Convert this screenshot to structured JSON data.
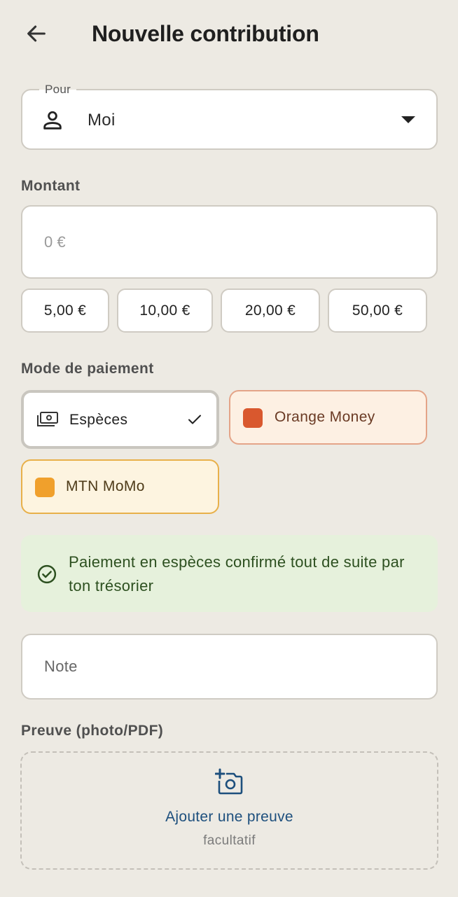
{
  "header": {
    "title": "Nouvelle contribution"
  },
  "pour": {
    "legend": "Pour",
    "value": "Moi"
  },
  "montant": {
    "label": "Montant",
    "placeholder": "0 €",
    "presets": [
      "5,00 €",
      "10,00 €",
      "20,00 €",
      "50,00 €"
    ]
  },
  "paiement": {
    "label": "Mode de paiement",
    "options": [
      {
        "label": "Espèces",
        "selected": true
      },
      {
        "label": "Orange Money",
        "selected": false,
        "color": "#d9582e"
      },
      {
        "label": "MTN MoMo",
        "selected": false,
        "color": "#f0a02c"
      }
    ]
  },
  "info": {
    "text": "Paiement en espèces confirmé tout de suite par ton trésorier"
  },
  "note": {
    "placeholder": "Note"
  },
  "preuve": {
    "label": "Preuve (photo/PDF)",
    "add_label": "Ajouter une preuve",
    "optional": "facultatif"
  },
  "colors": {
    "background": "#edeae3",
    "accent_blue": "#1d4f7d",
    "success_bg": "#e6f1dc",
    "success_text": "#2d5020"
  }
}
